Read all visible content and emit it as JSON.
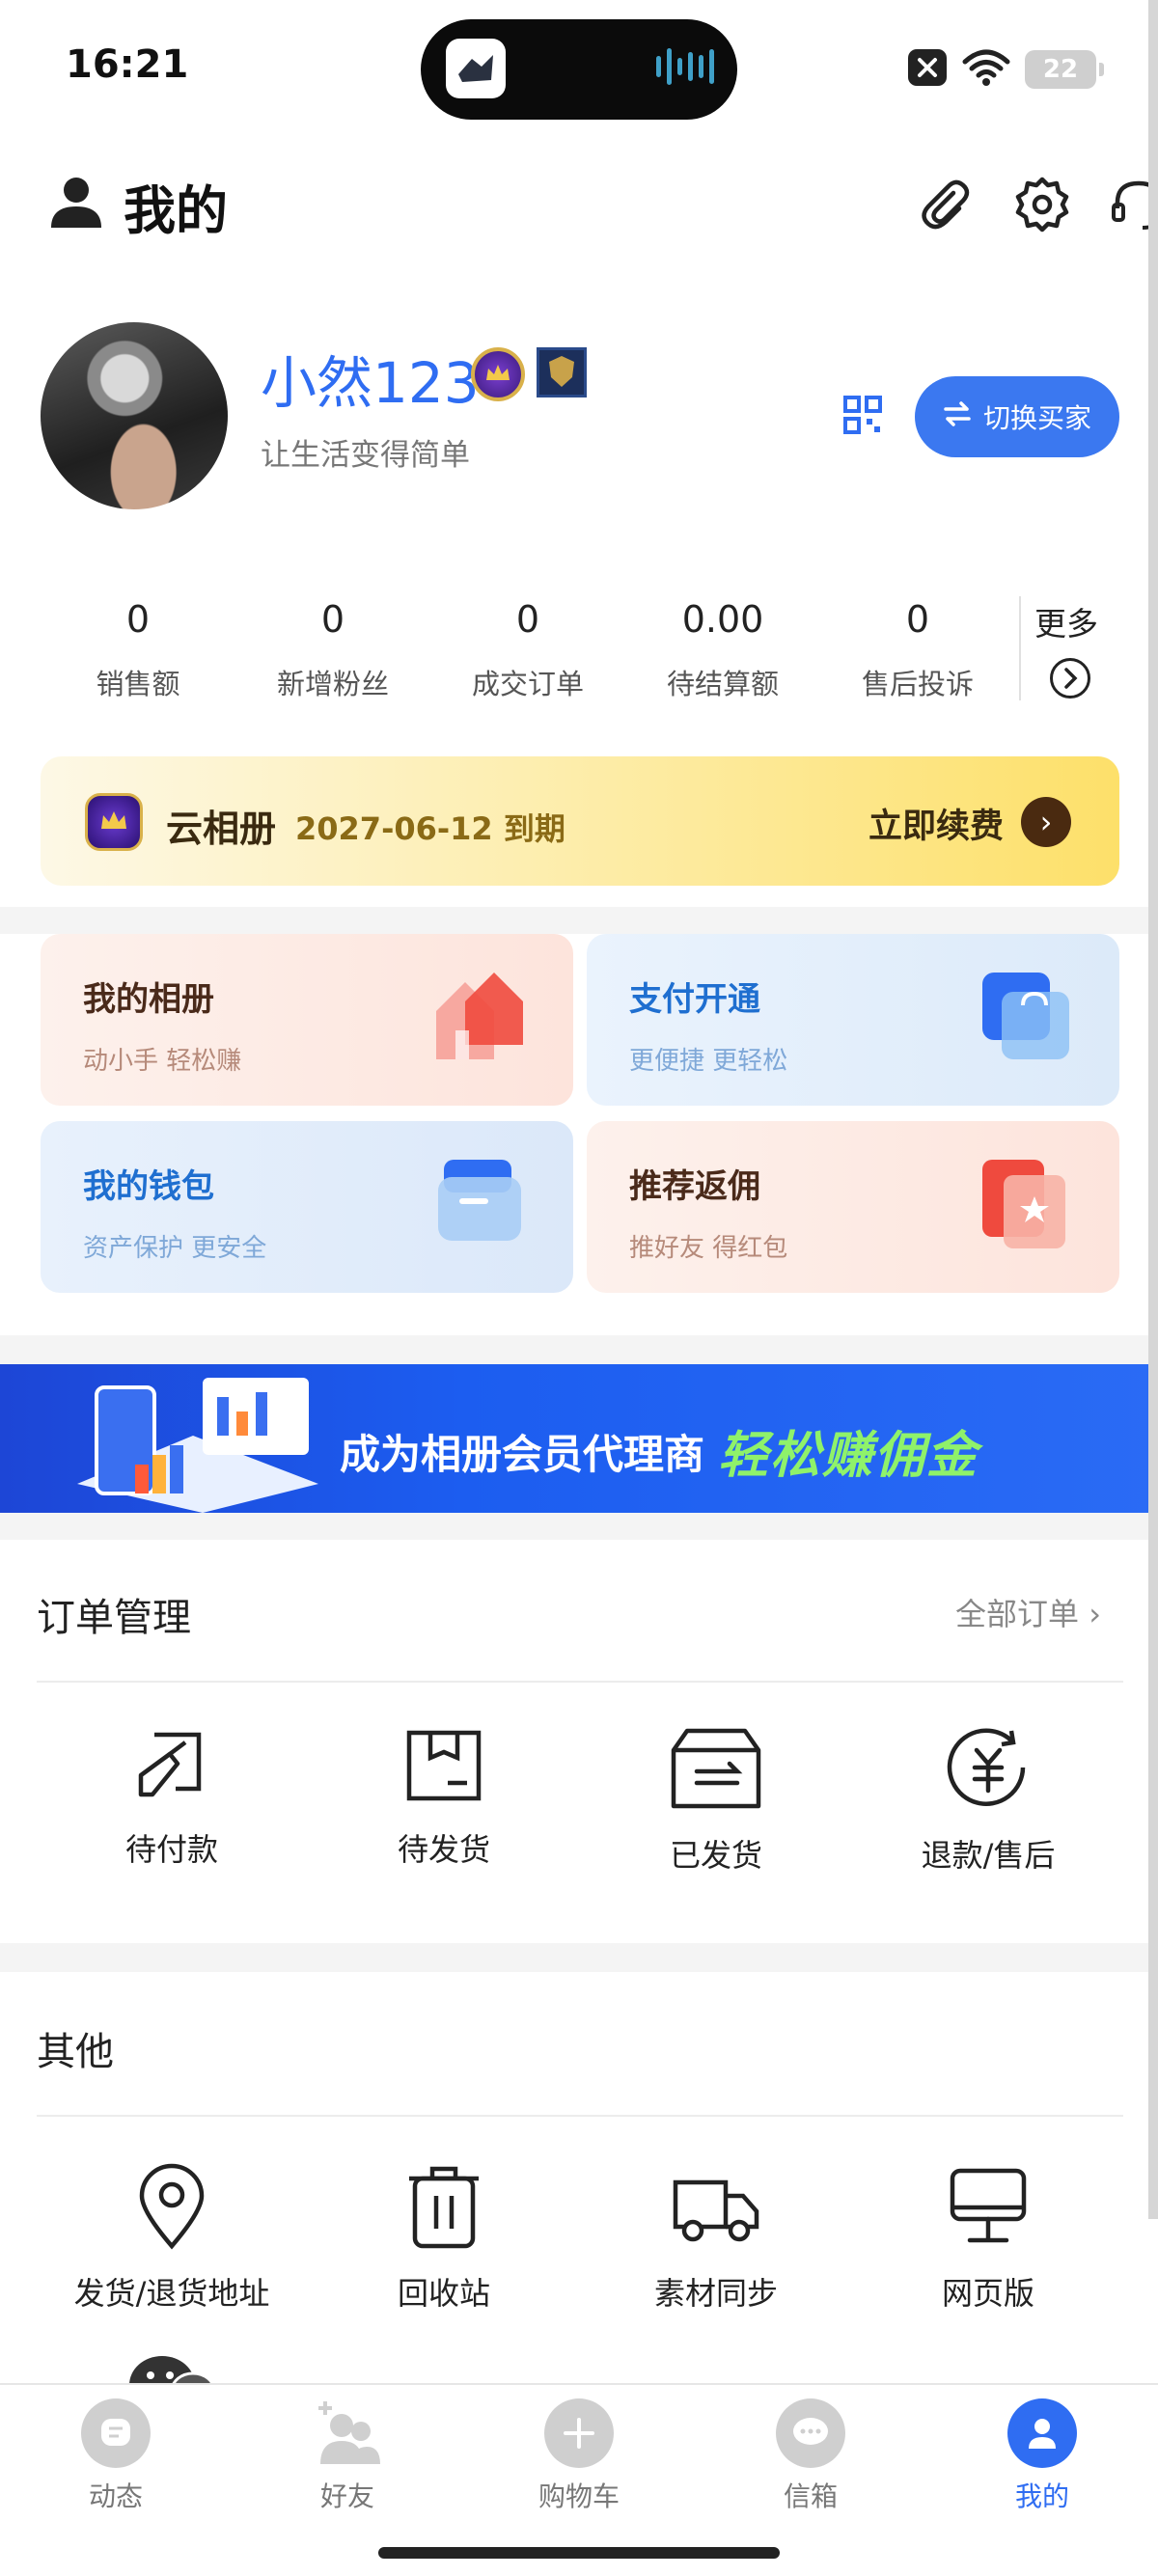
{
  "status_bar": {
    "time": "16:21",
    "battery": "22"
  },
  "header": {
    "title": "我的"
  },
  "profile": {
    "username": "小然123",
    "slogan": "让生活变得简单",
    "switch_button": "切换买家"
  },
  "stats": [
    {
      "value": "0",
      "label": "销售额"
    },
    {
      "value": "0",
      "label": "新增粉丝"
    },
    {
      "value": "0",
      "label": "成交订单"
    },
    {
      "value": "0.00",
      "label": "待结算额"
    },
    {
      "value": "0",
      "label": "售后投诉"
    }
  ],
  "stats_more": "更多",
  "vip_banner": {
    "title": "云相册",
    "date": "2027-06-12 到期",
    "renew": "立即续费"
  },
  "cards": [
    {
      "title": "我的相册",
      "subtitle": "动小手 轻松赚"
    },
    {
      "title": "支付开通",
      "subtitle": "更便捷 更轻松"
    },
    {
      "title": "我的钱包",
      "subtitle": "资产保护 更安全"
    },
    {
      "title": "推荐返佣",
      "subtitle": "推好友 得红包"
    }
  ],
  "promo": {
    "text1": "成为相册会员代理商",
    "text2": "轻松赚佣金"
  },
  "orders": {
    "title": "订单管理",
    "all_link": "全部订单",
    "items": [
      {
        "label": "待付款",
        "icon": "pending-payment-icon"
      },
      {
        "label": "待发货",
        "icon": "box-icon"
      },
      {
        "label": "已发货",
        "icon": "shipped-icon"
      },
      {
        "label": "退款/售后",
        "icon": "refund-icon"
      }
    ]
  },
  "others": {
    "title": "其他",
    "items": [
      {
        "label": "发货/退货地址",
        "icon": "location-pin-icon"
      },
      {
        "label": "回收站",
        "icon": "trash-icon"
      },
      {
        "label": "素材同步",
        "icon": "truck-icon"
      },
      {
        "label": "网页版",
        "icon": "monitor-icon"
      }
    ]
  },
  "tabbar": [
    {
      "label": "动态",
      "icon": "moments-icon"
    },
    {
      "label": "好友",
      "icon": "friends-icon"
    },
    {
      "label": "购物车",
      "icon": "plus-icon"
    },
    {
      "label": "信箱",
      "icon": "message-icon"
    },
    {
      "label": "我的",
      "icon": "profile-icon",
      "active": true
    }
  ],
  "colors": {
    "accent": "#2f6df2",
    "active_tab": "#2f6df2"
  }
}
